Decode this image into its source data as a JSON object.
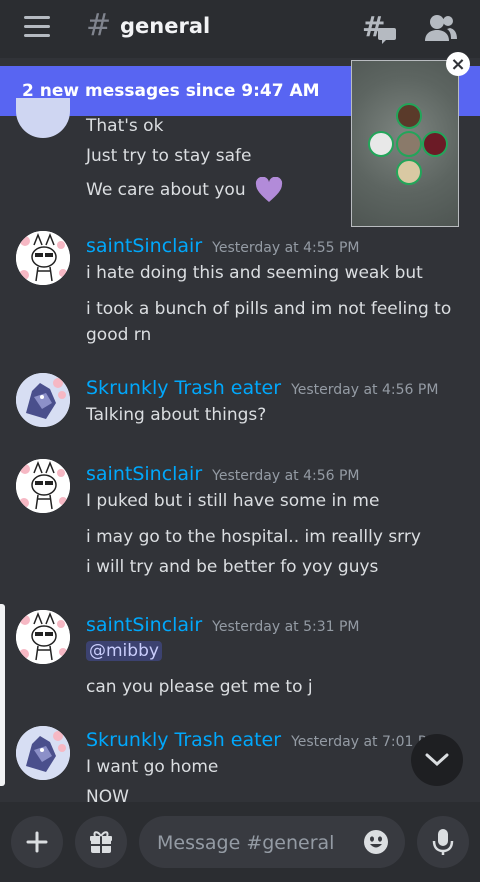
{
  "header": {
    "hash": "#",
    "channel_name": "general",
    "threads_icon": "threads-icon",
    "members_icon": "members-icon"
  },
  "banner": {
    "text": "2 new messages since 9:47 AM"
  },
  "messages": [
    {
      "continuation": true,
      "lines": [
        "That's ok",
        "Just try to stay safe",
        "We care about you"
      ]
    },
    {
      "author": "saintSinclair",
      "timestamp": "Yesterday at 4:55 PM",
      "lines": [
        "i hate doing this and seeming weak but",
        "i took a bunch of pills and im not feeling to",
        "good rn"
      ]
    },
    {
      "author": "Skrunkly Trash eater",
      "timestamp": "Yesterday at 4:56 PM",
      "lines": [
        "Talking about things?"
      ]
    },
    {
      "author": "saintSinclair",
      "timestamp": "Yesterday at 4:56 PM",
      "lines": [
        "I puked but i still have some in me",
        "i may go to the hospital.. im reallly srry",
        "i will try and be better fo yoy guys"
      ]
    },
    {
      "author": "saintSinclair",
      "timestamp": "Yesterday at 5:31 PM",
      "mention": "@mibby",
      "lines": [
        "can you please get me to j"
      ]
    },
    {
      "author": "Skrunkly Trash eater",
      "timestamp": "Yesterday at 7:01 P",
      "lines": [
        "I want go home",
        "NOW"
      ]
    }
  ],
  "composer": {
    "placeholder": "Message #general",
    "add_icon": "plus-icon",
    "gift_icon": "gift-icon",
    "emoji_icon": "emoji-icon",
    "mic_icon": "mic-icon"
  },
  "pip": {
    "close_label": "×"
  },
  "colors": {
    "accent": "#5865f2",
    "username": "#00a8fc",
    "background": "#313338",
    "header": "#2b2d31"
  }
}
